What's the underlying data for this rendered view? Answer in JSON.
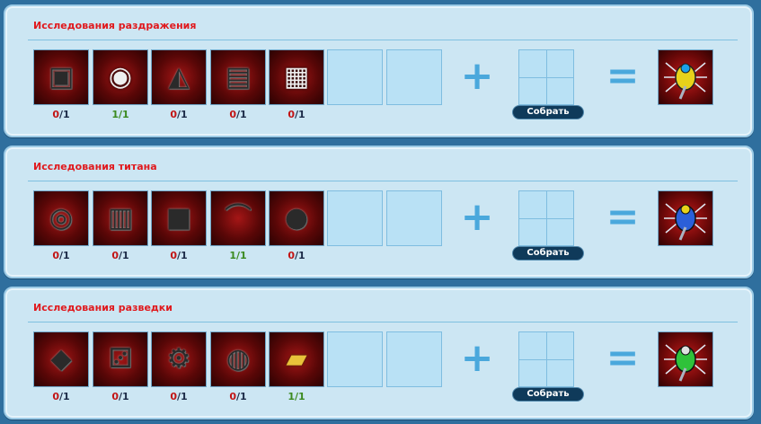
{
  "panels": [
    {
      "title": "Исследования раздражения",
      "items": [
        {
          "icon": "device-icon",
          "have": "0",
          "need": "1"
        },
        {
          "icon": "robot-icon",
          "have": "1",
          "need": "1"
        },
        {
          "icon": "cockpit-icon",
          "have": "0",
          "need": "1"
        },
        {
          "icon": "machine-icon",
          "have": "0",
          "need": "1"
        },
        {
          "icon": "screen-icon",
          "have": "0",
          "need": "1"
        }
      ],
      "reward": {
        "icon": "spider-robot-yellow-icon",
        "color": "#e8d21a"
      },
      "button": "Собрать"
    },
    {
      "title": "Исследования титана",
      "items": [
        {
          "icon": "disc-icon",
          "have": "0",
          "need": "1"
        },
        {
          "icon": "plate-icon",
          "have": "0",
          "need": "1"
        },
        {
          "icon": "block-icon",
          "have": "0",
          "need": "1"
        },
        {
          "icon": "blade-icon",
          "have": "1",
          "need": "1"
        },
        {
          "icon": "sphere-icon",
          "have": "0",
          "need": "1"
        }
      ],
      "reward": {
        "icon": "spider-robot-blue-icon",
        "color": "#2b5fd9"
      },
      "button": "Собрать"
    },
    {
      "title": "Исследования разведки",
      "items": [
        {
          "icon": "panel-icon",
          "have": "0",
          "need": "1"
        },
        {
          "icon": "dice-icon",
          "have": "0",
          "need": "1"
        },
        {
          "icon": "gear-icon",
          "have": "0",
          "need": "1"
        },
        {
          "icon": "lens-icon",
          "have": "0",
          "need": "1"
        },
        {
          "icon": "book-icon",
          "have": "1",
          "need": "1"
        }
      ],
      "reward": {
        "icon": "spider-robot-green-icon",
        "color": "#2fc23a"
      },
      "button": "Собрать"
    }
  ]
}
